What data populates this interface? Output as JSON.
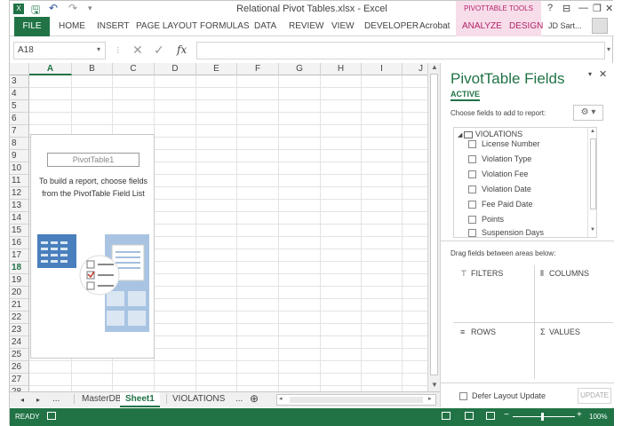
{
  "title": "Relational Pivot Tables.xlsx - Excel",
  "contextual_group": "PIVOTTABLE TOOLS",
  "window_controls": {
    "help": "?",
    "restore_ribbon": "⊟",
    "minimize": "—",
    "maximize": "❐",
    "close": "✕"
  },
  "tabs": {
    "file": "FILE",
    "items": [
      "HOME",
      "INSERT",
      "PAGE LAYOUT",
      "FORMULAS",
      "DATA",
      "REVIEW",
      "VIEW",
      "DEVELOPER",
      "Acrobat",
      "ANALYZE",
      "DESIGN"
    ]
  },
  "user": "JD Sart...",
  "formula_bar": {
    "name_box": "A18",
    "fx": "fx",
    "content": ""
  },
  "columns": [
    "A",
    "B",
    "C",
    "D",
    "E",
    "F",
    "G",
    "H",
    "I",
    "J"
  ],
  "rows": [
    "3",
    "4",
    "5",
    "6",
    "7",
    "8",
    "9",
    "10",
    "11",
    "12",
    "13",
    "14",
    "15",
    "16",
    "17",
    "18",
    "19",
    "20",
    "21",
    "22",
    "23",
    "24",
    "25",
    "26",
    "27",
    "28"
  ],
  "active_row": "18",
  "pivot": {
    "name": "PivotTable1",
    "hint": "To build a report, choose fields from the PivotTable Field List"
  },
  "sheets": {
    "nav": [
      "◂",
      "▸",
      "..."
    ],
    "tabs": [
      "MasterDB",
      "Sheet1",
      "VIOLATIONS"
    ],
    "active": "Sheet1",
    "more": "...",
    "add": "⊕"
  },
  "status": {
    "mode": "READY",
    "zoom": "100%"
  },
  "pane": {
    "title": "PivotTable Fields",
    "tab_active": "ACTIVE",
    "choose_label": "Choose fields to add to report:",
    "table_name": "VIOLATIONS",
    "fields": [
      "License Number",
      "Violation Type",
      "Violation Fee",
      "Violation Date",
      "Fee Paid Date",
      "Points",
      "Suspension Days"
    ],
    "drag_label": "Drag fields between areas below:",
    "areas": {
      "filters": "FILTERS",
      "columns": "COLUMNS",
      "rows": "ROWS",
      "values": "VALUES"
    },
    "defer_label": "Defer Layout Update",
    "update_label": "UPDATE"
  },
  "colors": {
    "excel_green": "#217346",
    "context_pink": "#b3236b",
    "context_bg": "#f7dde9"
  }
}
